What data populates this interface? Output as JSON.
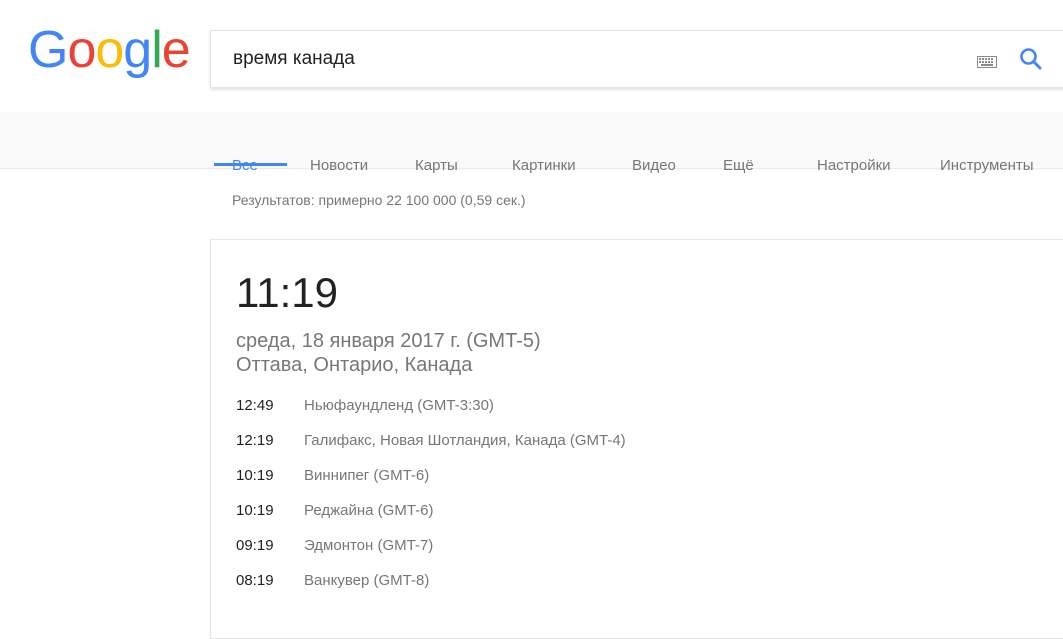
{
  "logo": {
    "letters": [
      "G",
      "o",
      "o",
      "g",
      "l",
      "e"
    ],
    "colors": [
      "#4285f4",
      "#ea4335",
      "#fbbc05",
      "#4285f4",
      "#34a853",
      "#ea4335"
    ]
  },
  "search": {
    "query": "время канада"
  },
  "tabs": [
    {
      "label": "Все",
      "active": true
    },
    {
      "label": "Новости",
      "active": false
    },
    {
      "label": "Карты",
      "active": false
    },
    {
      "label": "Картинки",
      "active": false
    },
    {
      "label": "Видео",
      "active": false
    },
    {
      "label": "Ещё",
      "active": false
    },
    {
      "label": "Настройки",
      "active": false
    },
    {
      "label": "Инструменты",
      "active": false
    }
  ],
  "stats": "Результатов: примерно 22 100 000 (0,59 сек.)",
  "card": {
    "time": "11:19",
    "date": "среда, 18 января 2017 г. (GMT-5)",
    "location": "Оттава, Онтарио, Канада",
    "zones": [
      {
        "time": "12:49",
        "place": "Ньюфаундленд (GMT-3:30)"
      },
      {
        "time": "12:19",
        "place": "Галифакс, Новая Шотландия, Канада (GMT-4)"
      },
      {
        "time": "10:19",
        "place": "Виннипег (GMT-6)"
      },
      {
        "time": "10:19",
        "place": "Реджайна (GMT-6)"
      },
      {
        "time": "09:19",
        "place": "Эдмонтон (GMT-7)"
      },
      {
        "time": "08:19",
        "place": "Ванкувер (GMT-8)"
      }
    ]
  },
  "colors": {
    "accent": "#4285f4",
    "muted": "#777777"
  }
}
